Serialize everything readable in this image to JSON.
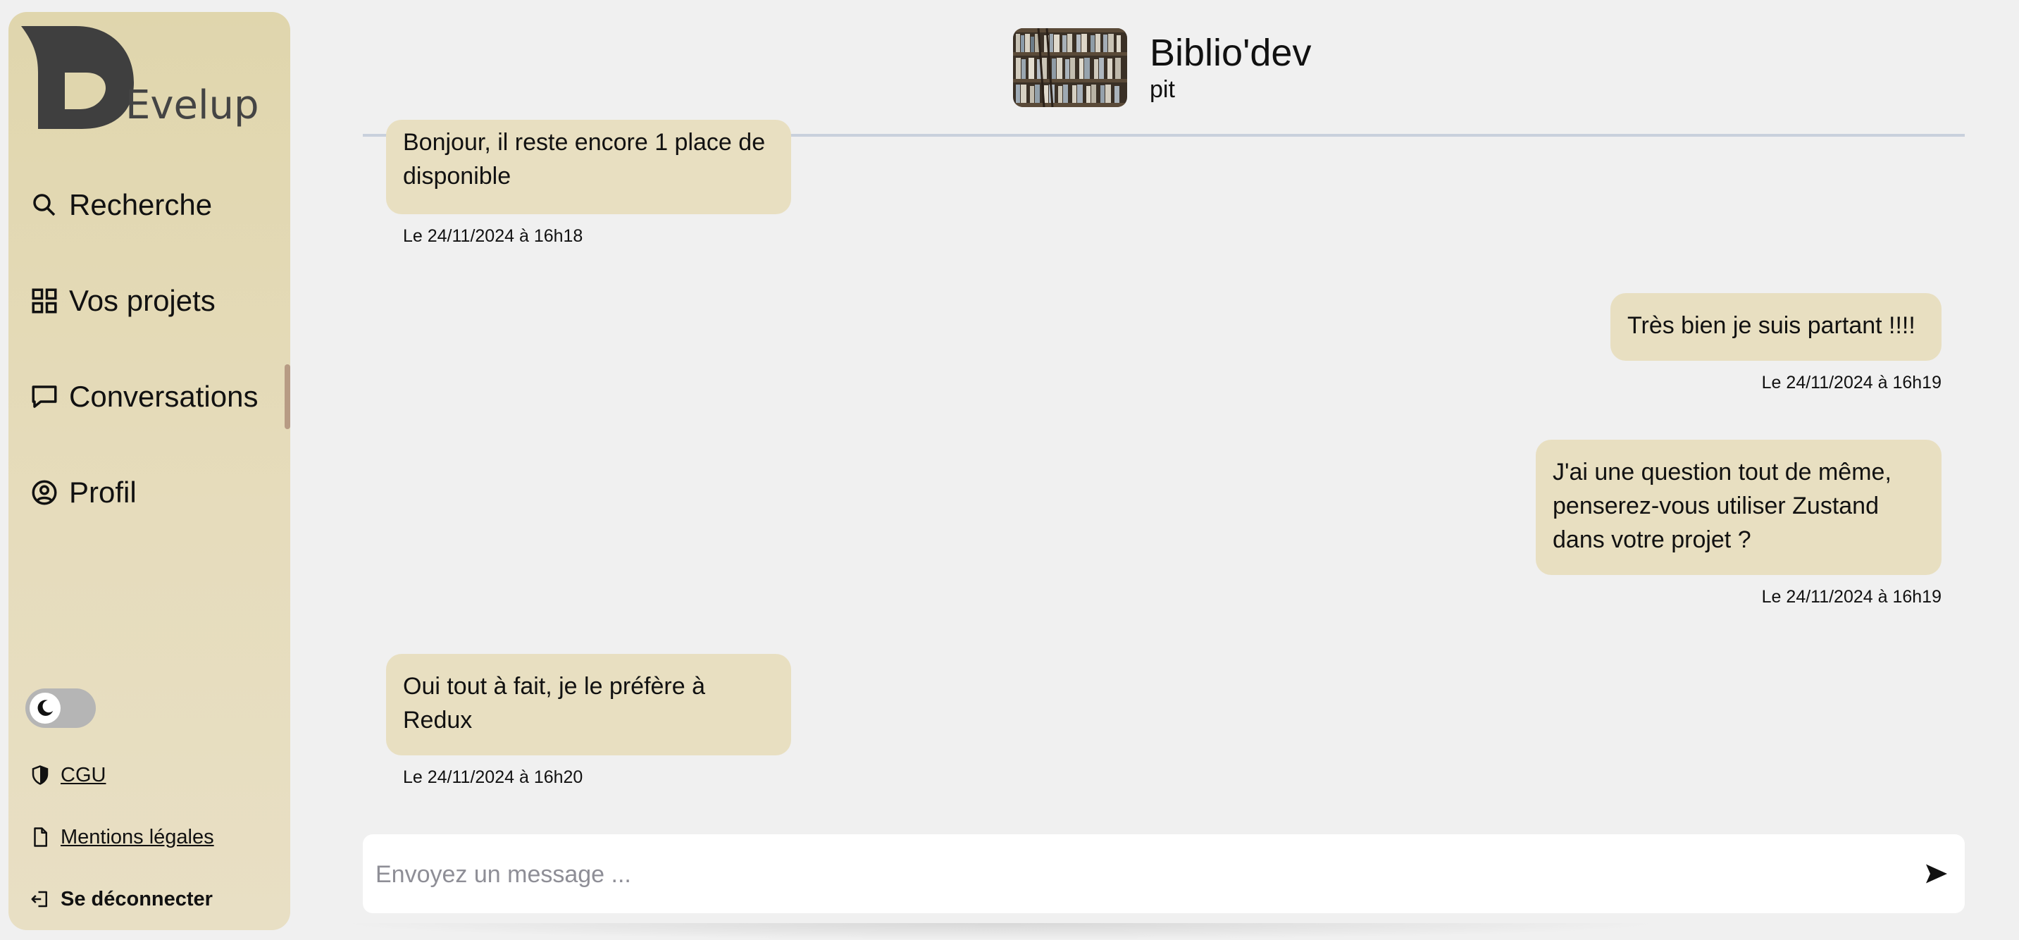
{
  "brand": {
    "logo_text": "Evelup"
  },
  "sidebar": {
    "items": [
      {
        "label": "Recherche",
        "icon": "search-icon"
      },
      {
        "label": "Vos projets",
        "icon": "grid-icon"
      },
      {
        "label": "Conversations",
        "icon": "chat-icon"
      },
      {
        "label": "Profil",
        "icon": "user-circle-icon"
      }
    ],
    "footer": [
      {
        "label": "CGU",
        "icon": "shield-icon"
      },
      {
        "label": "Mentions légales",
        "icon": "document-icon"
      },
      {
        "label": "Se déconnecter",
        "icon": "logout-icon"
      }
    ],
    "theme_toggle_icon": "moon-icon"
  },
  "header": {
    "title": "Biblio'dev",
    "subtitle": "pit",
    "avatar_icon": "bookshelf-image"
  },
  "messages": [
    {
      "side": "left",
      "text": "Bonjour, il reste encore 1 place de disponible",
      "time": "Le 24/11/2024 à 16h18"
    },
    {
      "side": "right",
      "text": "Très bien je suis partant !!!!",
      "time": "Le 24/11/2024 à 16h19"
    },
    {
      "side": "right",
      "text": "J'ai une question tout de même, penserez-vous utiliser Zustand dans votre projet ?",
      "time": "Le 24/11/2024 à 16h19"
    },
    {
      "side": "left",
      "text": "Oui tout à fait, je le préfère à Redux",
      "time": "Le 24/11/2024 à 16h20"
    }
  ],
  "composer": {
    "placeholder": "Envoyez un message ...",
    "value": "",
    "send_icon": "send-icon"
  },
  "colors": {
    "sidebar": "#e0d6ad",
    "bubble": "#e8dfc1",
    "background": "#f0f0f0",
    "active_indicator": "#b79b84"
  }
}
